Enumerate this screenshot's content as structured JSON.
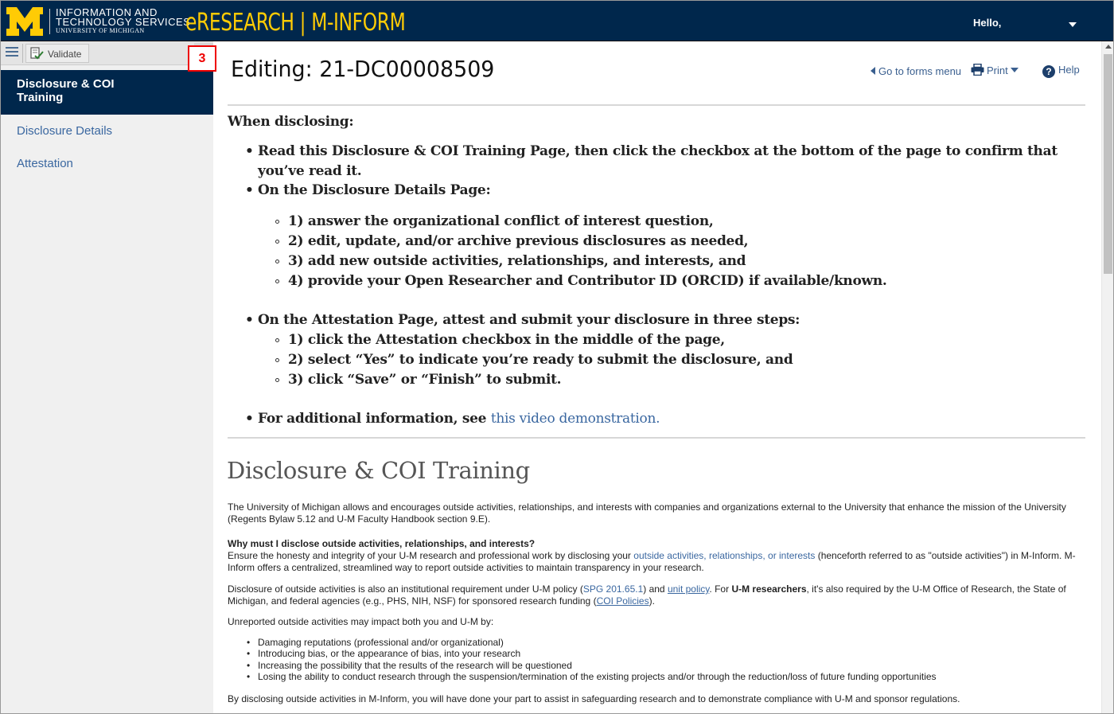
{
  "header": {
    "logo_letter": "M",
    "org_line1": "INFORMATION AND",
    "org_line2": "TECHNOLOGY SERVICES",
    "org_line3": "UNIVERSITY OF MICHIGAN",
    "app_name": "eRESEARCH | M-INFORM",
    "greeting": "Hello,",
    "colors": {
      "navy": "#00274c",
      "maize": "#ffcb05"
    }
  },
  "sidebar": {
    "menu_icon": "hamburger-icon",
    "validate_label": "Validate",
    "collapse_glyph": "«",
    "items": [
      {
        "label": "Disclosure & COI Training",
        "active": true
      },
      {
        "label": "Disclosure Details",
        "active": false
      },
      {
        "label": "Attestation",
        "active": false
      }
    ],
    "step_badge": "3"
  },
  "main": {
    "title": "Editing: 21-DC00008509",
    "toolbar": {
      "go_forms": "Go to forms menu",
      "print": "Print",
      "help": "Help"
    },
    "instructions": {
      "heading": "When disclosing:",
      "bullet1": "Read this Disclosure & COI Training Page, then click the checkbox at the bottom of the page to confirm that you’ve read it.",
      "bullet2": "On the Disclosure Details Page:",
      "details_steps": [
        "1) answer the organizational conflict of interest question,",
        "2) edit, update, and/or archive previous disclosures as needed,",
        "3) add new outside activities, relationships, and interests, and",
        "4) provide your Open Researcher and Contributor ID (ORCID) if available/known."
      ],
      "bullet3": "On the Attestation Page, attest and submit your disclosure in three steps:",
      "attest_steps": [
        "1) click the Attestation checkbox in the middle of the page,",
        "2) select “Yes” to indicate you’re ready to submit the disclosure, and",
        "3) click “Save” or “Finish” to submit."
      ],
      "bullet4_prefix": "For additional information, see ",
      "bullet4_link": "this video demonstration."
    },
    "training": {
      "heading": "Disclosure & COI Training",
      "p1": "The University of Michigan allows and encourages outside activities, relationships, and interests with companies and organizations external to the University that enhance the mission of the University (Regents Bylaw 5.12 and U-M Faculty Handbook section 9.E).",
      "why_heading": "Why must I disclose outside activities, relationships, and interests?",
      "p2_a": "Ensure the honesty and integrity of your U-M research and professional work by disclosing your ",
      "p2_link": "outside activities, relationships, or interests",
      "p2_b": " (henceforth referred to as \"outside activities\") in M-Inform. M-Inform offers a centralized, streamlined way to report outside activities to maintain transparency in your research.",
      "p3_a": "Disclosure of outside activities is also an institutional requirement under U-M policy (",
      "p3_link1": "SPG 201.65.1",
      "p3_b": ") and ",
      "p3_link2": "unit policy",
      "p3_c": ". For ",
      "p3_bold": "U-M researchers",
      "p3_d": ", it's also required by the U-M Office of Research, the State of Michigan, and federal agencies (e.g., PHS, NIH, NSF) for sponsored research funding (",
      "p3_link3": "COI Policies",
      "p3_e": ").",
      "p4": "Unreported outside activities may impact both you and U-M by:",
      "impacts": [
        "Damaging reputations (professional and/or organizational)",
        "Introducing bias, or the appearance of bias, into your research",
        "Increasing the possibility that the results of the research will be questioned",
        "Losing the ability to conduct research through the suspension/termination of the existing projects and/or through the reduction/loss of future funding opportunities"
      ],
      "p5": "By disclosing outside activities in M-Inform, you will have done your part to assist in safeguarding research and to demonstrate compliance with U-M and sponsor regulations."
    }
  }
}
